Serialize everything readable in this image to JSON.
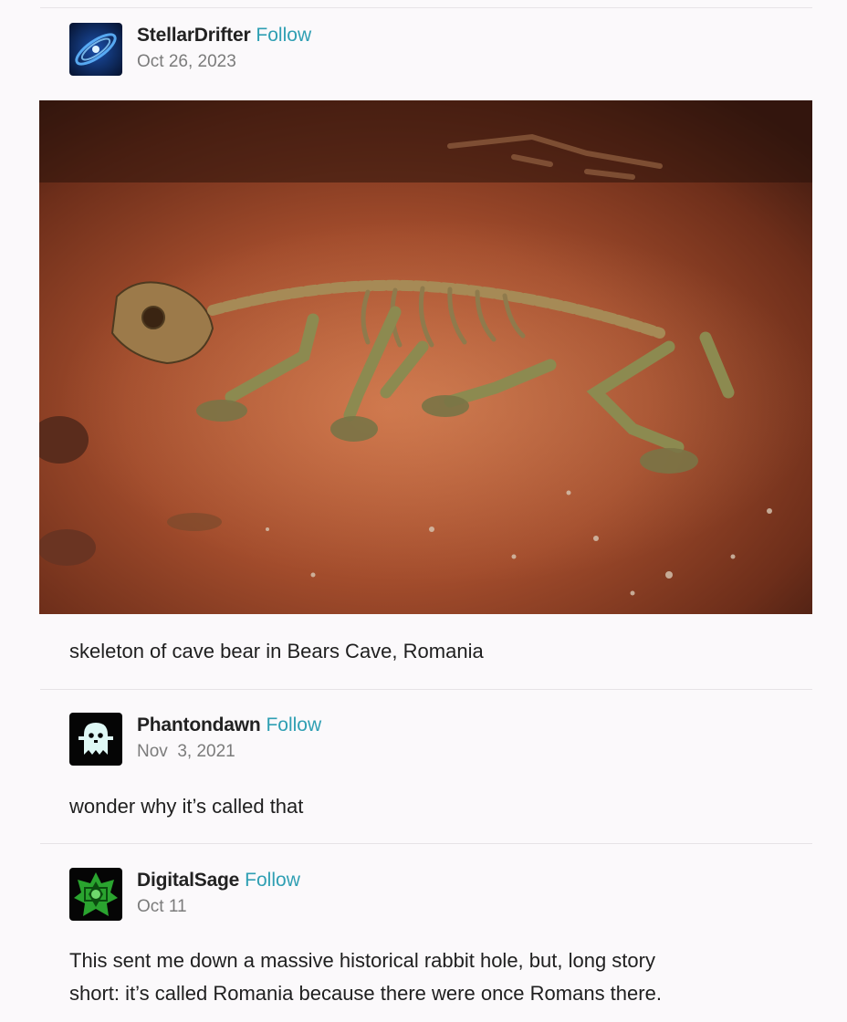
{
  "posts": [
    {
      "username": "StellarDrifter",
      "follow_label": "Follow",
      "date": "Oct 26, 2023",
      "avatar_icon": "galaxy-icon",
      "caption": "skeleton of cave bear in Bears Cave, Romania",
      "photo_subject": "cave-bear-skeleton-photo"
    },
    {
      "username": "Phantondawn",
      "follow_label": "Follow",
      "date": "Nov  3, 2021",
      "avatar_icon": "ghost-icon",
      "caption": "wonder why it’s called that"
    },
    {
      "username": "DigitalSage",
      "follow_label": "Follow",
      "date": "Oct 11",
      "avatar_icon": "green-star-icon",
      "caption_lines": [
        "This sent me down a massive historical rabbit hole, but, long story",
        "short: it’s called Romania because there were once Romans there."
      ]
    }
  ],
  "colors": {
    "follow": "#2f9fb3",
    "background": "#fbf9fb",
    "divider": "#e6e3e6",
    "date": "#7b7b7b"
  }
}
